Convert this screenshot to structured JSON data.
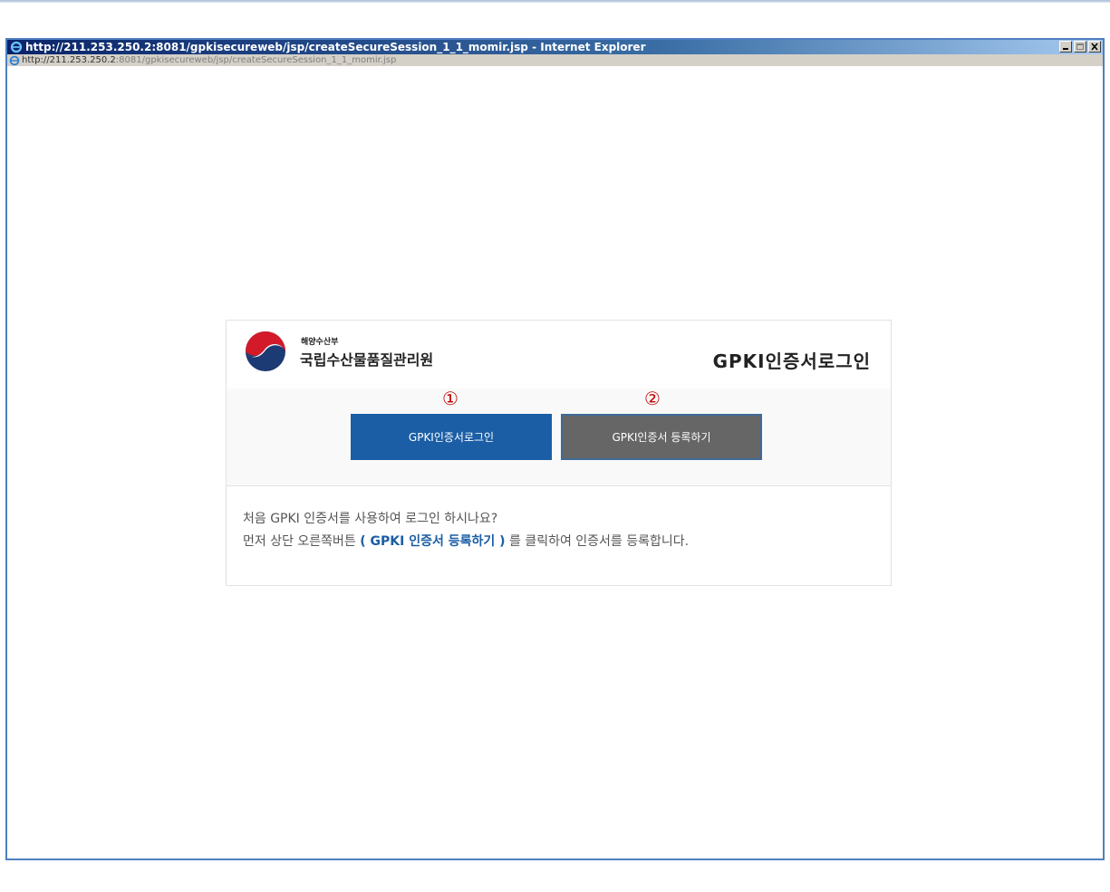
{
  "window": {
    "title": "http://211.253.250.2:8081/gpkisecureweb/jsp/createSecureSession_1_1_momir.jsp - Internet Explorer",
    "address_host": "http://211.253.250.2",
    "address_rest": ":8081/gpkisecureweb/jsp/createSecureSession_1_1_momir.jsp"
  },
  "header": {
    "ministry": "해양수산부",
    "org_name": "국립수산물품질관리원",
    "title": "GPKI인증서로그인"
  },
  "markers": {
    "first": "①",
    "second": "②"
  },
  "buttons": {
    "login": "GPKI인증서로그인",
    "register": "GPKI인증서 등록하기"
  },
  "info": {
    "line1": "처음 GPKI 인증서를 사용하여 로그인 하시나요?",
    "line2_prefix": "먼저 상단 오른쪽버튼 ",
    "line2_highlight": "( GPKI 인증서 등록하기 )",
    "line2_suffix": " 를 클릭하여 인증서를 등록합니다."
  },
  "colors": {
    "primary_button": "#1b5ea6",
    "secondary_button": "#666666",
    "marker": "#c00000",
    "window_border": "#4f7fc1"
  }
}
